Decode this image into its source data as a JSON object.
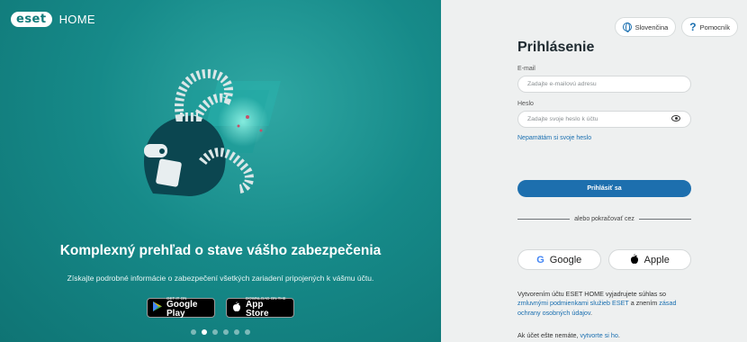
{
  "brand": {
    "logo_text": "eset",
    "product": "HOME"
  },
  "hero": {
    "title": "Komplexný prehľad o stave vášho zabezpečenia",
    "subtitle": "Získajte podrobné informácie o zabezpečení všetkých zariadení pripojených k vášmu účtu."
  },
  "stores": {
    "google": {
      "small": "GET IT ON",
      "big": "Google Play",
      "icon": "google-play-icon"
    },
    "apple": {
      "small": "Download on the",
      "big": "App Store",
      "icon": "apple-icon"
    }
  },
  "carousel": {
    "count": 6,
    "active_index": 1
  },
  "topbar": {
    "language_label": "Slovenčina",
    "help_label": "Pomocník"
  },
  "login": {
    "title": "Prihlásenie",
    "email_label": "E-mail",
    "email_placeholder": "Zadajte e-mailovú adresu",
    "password_label": "Heslo",
    "password_placeholder": "Zadajte svoje heslo k účtu",
    "forgot_label": "Nepamätám si svoje heslo",
    "submit_label": "Prihlásiť sa",
    "divider_label": "alebo pokračovať cez",
    "google_label": "Google",
    "apple_label": "Apple"
  },
  "legal": {
    "part1": "Vytvorením účtu ESET HOME vyjadrujete súhlas so ",
    "terms_link": "zmluvnými podmienkami služieb ESET",
    "part2": " a znením ",
    "privacy_link": "zásad ochrany osobných údajov",
    "part3": ".",
    "no_account_text": "Ak účet ešte nemáte, ",
    "create_link": "vytvorte si ho",
    "no_account_end": "."
  },
  "colors": {
    "accent": "#1d6fae",
    "teal": "#168a89",
    "link": "#1a6fb0"
  }
}
